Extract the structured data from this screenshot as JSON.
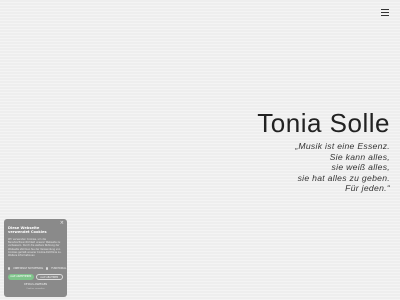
{
  "menu": {
    "icon": "hamburger-icon"
  },
  "hero": {
    "name": "Tonia Solle",
    "quote": [
      "„Musik ist eine Essenz.",
      "Sie kann alles,",
      "sie weiß alles,",
      "sie hat alles zu geben.",
      "Für jeden.“"
    ]
  },
  "cookie_banner": {
    "close": "×",
    "title": "Diese Webseite verwendet Cookies",
    "text": "Wir verwenden Cookies, um die Benutzerfreundlichkeit unserer Webseite zu verbessern. Durch die weitere Nutzung der Webseite stimmen Sie der Verwendung von Cookies gemäß unserer Cookie-Richtlinie zu. Weitere Informationen",
    "check_necessary": "UNBEDINGT NOTWENDIG",
    "check_functional": "FUNKTIONAL",
    "accept_label": "ALLE AKZEPTIEREN",
    "reject_label": "ALLE ABLEHNEN",
    "details_label": "DETAILS ANZEIGEN",
    "bottom_text": "Cookies verwalten",
    "colors": {
      "background": "#8a8a8a",
      "accept": "#7fc48b"
    }
  }
}
